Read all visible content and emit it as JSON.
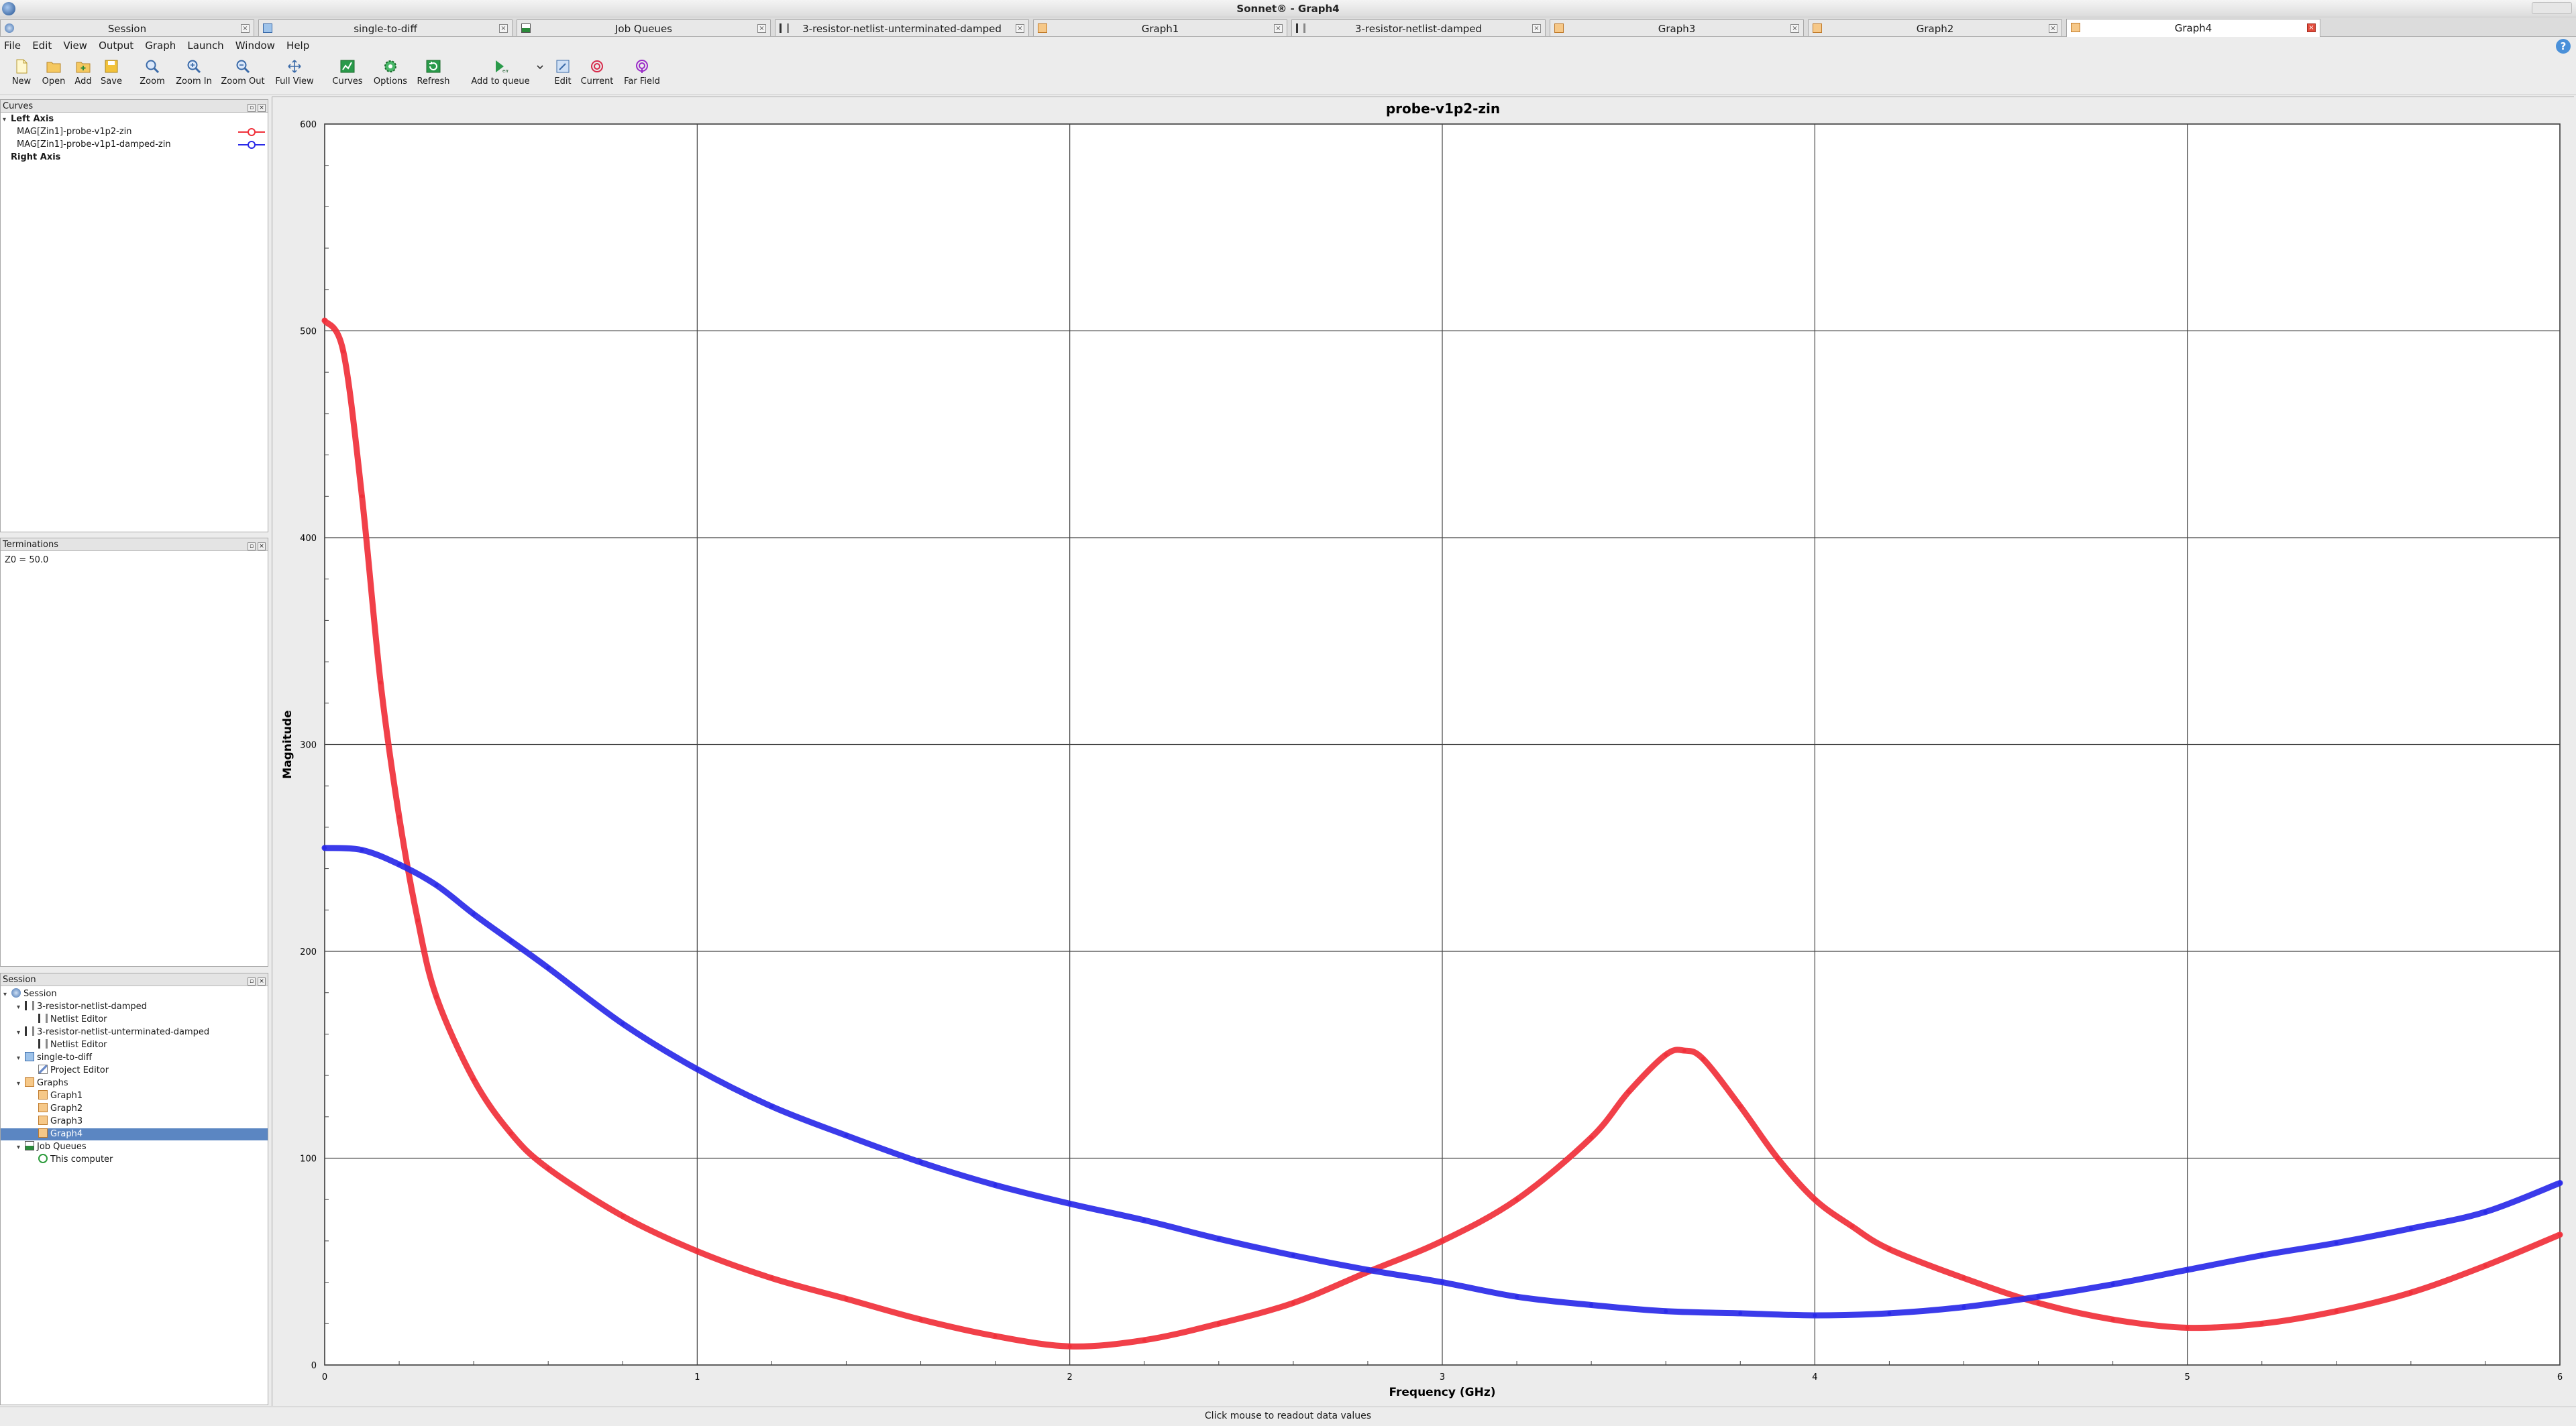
{
  "window": {
    "title": "Sonnet® - Graph4"
  },
  "tabs": [
    {
      "label": "Session",
      "icon": "session-icon"
    },
    {
      "label": "single-to-diff",
      "icon": "project-icon"
    },
    {
      "label": "Job Queues",
      "icon": "job-queue-icon"
    },
    {
      "label": "3-resistor-netlist-unterminated-damped",
      "icon": "netlist-icon"
    },
    {
      "label": "Graph1",
      "icon": "graph-icon"
    },
    {
      "label": "3-resistor-netlist-damped",
      "icon": "netlist-icon"
    },
    {
      "label": "Graph3",
      "icon": "graph-icon"
    },
    {
      "label": "Graph2",
      "icon": "graph-icon"
    },
    {
      "label": "Graph4",
      "icon": "graph-icon",
      "active": true
    }
  ],
  "menu": [
    "File",
    "Edit",
    "View",
    "Output",
    "Graph",
    "Launch",
    "Window",
    "Help"
  ],
  "toolbar": {
    "new": "New",
    "open": "Open",
    "add": "Add",
    "save": "Save",
    "zoom": "Zoom",
    "zoom_in": "Zoom In",
    "zoom_out": "Zoom Out",
    "full_view": "Full View",
    "curves": "Curves",
    "options": "Options",
    "refresh": "Refresh",
    "add_to_queue": "Add to queue",
    "edit": "Edit",
    "current": "Current",
    "far_field": "Far Field"
  },
  "curves_panel": {
    "title": "Curves",
    "left_axis": "Left Axis",
    "right_axis": "Right Axis",
    "items": [
      {
        "label": "MAG[Zin1]-probe-v1p2-zin",
        "color": "#f0303a"
      },
      {
        "label": "MAG[Zin1]-probe-v1p1-damped-zin",
        "color": "#2a2ae8"
      }
    ]
  },
  "terminations_panel": {
    "title": "Terminations",
    "text": "Z0 = 50.0"
  },
  "session_panel": {
    "title": "Session",
    "tree": [
      {
        "label": "Session",
        "depth": 0,
        "icon": "session-icon"
      },
      {
        "label": "3-resistor-netlist-damped",
        "depth": 1,
        "icon": "netlist-icon"
      },
      {
        "label": "Netlist Editor",
        "depth": 2,
        "icon": "netlist-icon"
      },
      {
        "label": "3-resistor-netlist-unterminated-damped",
        "depth": 1,
        "icon": "netlist-icon"
      },
      {
        "label": "Netlist Editor",
        "depth": 2,
        "icon": "netlist-icon"
      },
      {
        "label": "single-to-diff",
        "depth": 1,
        "icon": "project-icon"
      },
      {
        "label": "Project Editor",
        "depth": 2,
        "icon": "pen-icon"
      },
      {
        "label": "Graphs",
        "depth": 1,
        "icon": "graph-icon"
      },
      {
        "label": "Graph1",
        "depth": 2,
        "icon": "graph-icon"
      },
      {
        "label": "Graph2",
        "depth": 2,
        "icon": "graph-icon"
      },
      {
        "label": "Graph3",
        "depth": 2,
        "icon": "graph-icon"
      },
      {
        "label": "Graph4",
        "depth": 2,
        "icon": "graph-icon",
        "selected": true
      },
      {
        "label": "Job Queues",
        "depth": 1,
        "icon": "job-queue-icon"
      },
      {
        "label": "This computer",
        "depth": 2,
        "icon": "check-icon"
      }
    ]
  },
  "status_bar": {
    "text": "Click mouse to readout data values"
  },
  "chart_data": {
    "type": "line",
    "title": "probe-v1p2-zin",
    "xlabel": "Frequency (GHz)",
    "ylabel": "Magnitude",
    "xlim": [
      0,
      6
    ],
    "ylim": [
      0,
      600
    ],
    "xticks": [
      "0",
      "1",
      "2",
      "3",
      "4",
      "5",
      "6"
    ],
    "yticks": [
      "0",
      "100",
      "200",
      "300",
      "400",
      "500",
      "600"
    ],
    "grid": true,
    "legend": "none",
    "series": [
      {
        "name": "MAG[Zin1]-probe-v1p2-zin",
        "color": "#f0303a",
        "x": [
          0,
          0.05,
          0.1,
          0.15,
          0.2,
          0.25,
          0.3,
          0.4,
          0.5,
          0.6,
          0.8,
          1.0,
          1.2,
          1.4,
          1.6,
          1.8,
          2.0,
          2.2,
          2.4,
          2.6,
          2.8,
          3.0,
          3.2,
          3.4,
          3.5,
          3.6,
          3.65,
          3.7,
          3.8,
          3.9,
          4.0,
          4.1,
          4.2,
          4.4,
          4.6,
          4.8,
          5.0,
          5.2,
          5.4,
          5.6,
          5.8,
          6.0
        ],
        "y": [
          505,
          490,
          420,
          330,
          265,
          215,
          178,
          138,
          112,
          95,
          72,
          55,
          42,
          32,
          22,
          14,
          9,
          12,
          20,
          30,
          45,
          60,
          80,
          110,
          132,
          150,
          152,
          148,
          125,
          100,
          80,
          67,
          56,
          42,
          30,
          22,
          18,
          20,
          26,
          35,
          48,
          63
        ]
      },
      {
        "name": "MAG[Zin1]-probe-v1p1-damped-zin",
        "color": "#2a2ae8",
        "x": [
          0,
          0.1,
          0.2,
          0.3,
          0.4,
          0.5,
          0.6,
          0.8,
          1.0,
          1.2,
          1.4,
          1.6,
          1.8,
          2.0,
          2.2,
          2.4,
          2.6,
          2.8,
          3.0,
          3.2,
          3.4,
          3.6,
          3.8,
          4.0,
          4.2,
          4.4,
          4.6,
          4.8,
          5.0,
          5.2,
          5.4,
          5.6,
          5.8,
          6.0
        ],
        "y": [
          250,
          249,
          242,
          232,
          218,
          205,
          192,
          165,
          143,
          125,
          111,
          98,
          87,
          78,
          70,
          61,
          53,
          46,
          40,
          33,
          29,
          26,
          25,
          24,
          25,
          28,
          33,
          39,
          46,
          53,
          59,
          66,
          74,
          88
        ]
      }
    ]
  }
}
